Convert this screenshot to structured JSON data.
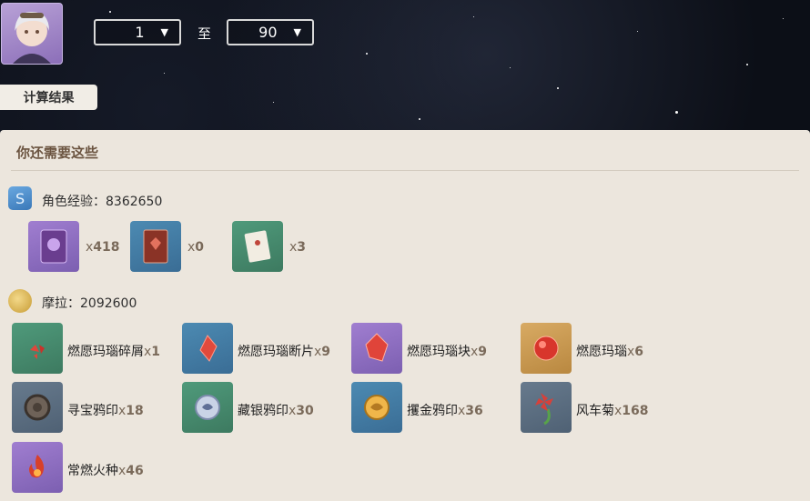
{
  "header": {
    "level_from": "1",
    "level_to": "90",
    "to_label": "至",
    "calc_label": "计算结果"
  },
  "panel": {
    "title": "你还需要这些",
    "exp": {
      "label": "角色经验",
      "value": "8362650"
    },
    "exp_items": [
      {
        "icon": "purple-exp-book-icon",
        "x": "x",
        "qty": "418"
      },
      {
        "icon": "blue-exp-book-icon",
        "x": "x",
        "qty": "0"
      },
      {
        "icon": "green-exp-book-icon",
        "x": "x",
        "qty": "3"
      }
    ],
    "mora": {
      "label": "摩拉",
      "value": "2092600"
    },
    "materials": [
      {
        "name": "燃愿玛瑙碎屑",
        "x": "x",
        "qty": "1",
        "icon": "agate-sliver-icon"
      },
      {
        "name": "燃愿玛瑙断片",
        "x": "x",
        "qty": "9",
        "icon": "agate-fragment-icon"
      },
      {
        "name": "燃愿玛瑙块",
        "x": "x",
        "qty": "9",
        "icon": "agate-chunk-icon"
      },
      {
        "name": "燃愿玛瑙",
        "x": "x",
        "qty": "6",
        "icon": "agate-gemstone-icon"
      },
      {
        "name": "寻宝鸦印",
        "x": "x",
        "qty": "18",
        "icon": "treasure-hoarder-insignia-icon"
      },
      {
        "name": "藏银鸦印",
        "x": "x",
        "qty": "30",
        "icon": "silver-raven-insignia-icon"
      },
      {
        "name": "攫金鸦印",
        "x": "x",
        "qty": "36",
        "icon": "golden-raven-insignia-icon"
      },
      {
        "name": "风车菊",
        "x": "x",
        "qty": "168",
        "icon": "windwheel-aster-icon"
      },
      {
        "name": "常燃火种",
        "x": "x",
        "qty": "46",
        "icon": "everflame-seed-icon"
      }
    ]
  }
}
